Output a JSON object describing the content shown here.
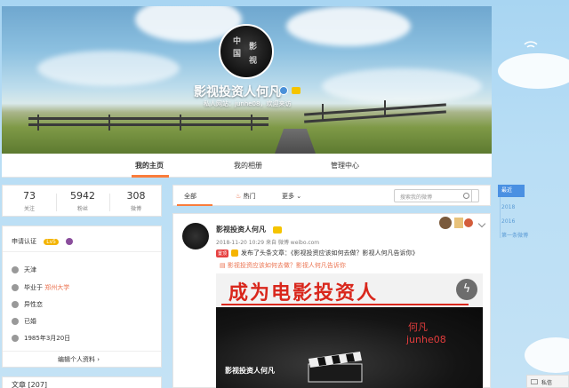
{
  "profile": {
    "name": "影视投资人何凡",
    "subtitle": "私人网站：junhe08，欢迎来访"
  },
  "nav": {
    "tabs": [
      {
        "label": "我的主页"
      },
      {
        "label": "我的相册"
      },
      {
        "label": "管理中心"
      }
    ]
  },
  "stats": [
    {
      "value": "73",
      "label": "关注"
    },
    {
      "value": "5942",
      "label": "粉丝"
    },
    {
      "value": "308",
      "label": "微博"
    }
  ],
  "info": {
    "verify": "申请认证",
    "level": "Lv5",
    "city": "天津",
    "school_prefix": "毕业于",
    "school": "郑州大学",
    "orientation": "异性恋",
    "marital": "已婚",
    "birthday": "1985年3月20日",
    "edit": "编辑个人资料 ›"
  },
  "articles": {
    "label": "文章 [207]"
  },
  "feed": {
    "filters": {
      "all": "全部",
      "hot": "热门",
      "more": "更多"
    },
    "search_placeholder": "搜索我的微博"
  },
  "post": {
    "author": "影视投资人何凡",
    "meta": "2018-11-20 10:29 来自 微博 weibo.com",
    "headline_tag": "置顶",
    "line1": "发布了头条文章：《影视投资应该如何去做？影视人何凡告诉你》",
    "line2": "影视投资应该如何去做？影视人何凡告诉你",
    "poster": {
      "title": "成为电影投资人",
      "author": "何凡",
      "id": "junhe08",
      "caption": "影视投资人何凡"
    }
  },
  "timeline": {
    "latest": "最近",
    "years": [
      "2018",
      "2016"
    ],
    "first": "第一条微博"
  },
  "corner": {
    "label": "私信"
  }
}
